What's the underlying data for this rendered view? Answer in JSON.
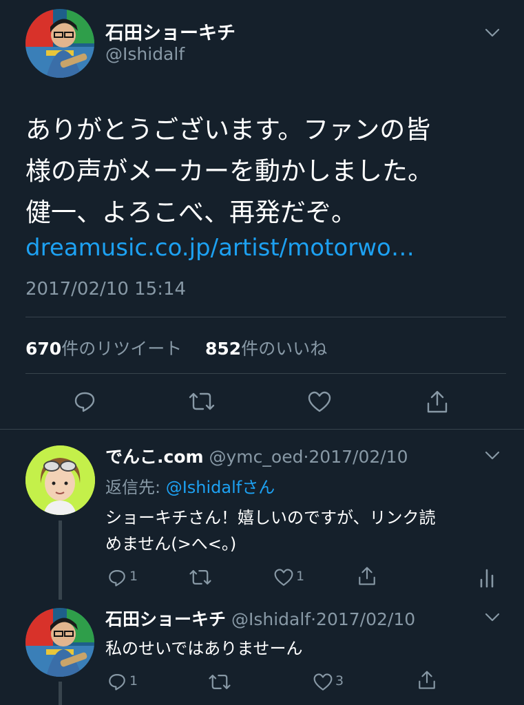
{
  "main_tweet": {
    "author_name": "石田ショーキチ",
    "author_handle": "@Ishidalf",
    "text_line1": "ありがとうございます。ファンの皆",
    "text_line2": "様の声がメーカーを動かしました。",
    "text_line3": "健一、よろこべ、再発だぞ。",
    "link": "dreamusic.co.jp/artist/motorwo…",
    "timestamp": "2017/02/10 15:14",
    "retweet_count": "670",
    "retweet_label": "件のリツイート",
    "like_count": "852",
    "like_label": "件のいいね"
  },
  "reply1": {
    "author_name": "でんこ.com",
    "author_handle": "@ymc_oed",
    "separator": "·",
    "date": "2017/02/10",
    "reply_to_label": "返信先: ",
    "reply_to_handle": "@Ishidalf",
    "reply_to_suffix": "さん",
    "text_line1": "ショーキチさん！嬉しいのですが、リンク読",
    "text_line2": "めません(>へ<。)",
    "reply_count": "1",
    "like_count": "1"
  },
  "reply2": {
    "author_name": "石田ショーキチ",
    "author_handle": "@Ishidalf",
    "separator": "·",
    "date": "2017/02/10",
    "text": "私のせいではありませーん",
    "reply_count": "1",
    "like_count": "3"
  },
  "icons": {
    "reply": "reply-icon",
    "retweet": "retweet-icon",
    "like": "heart-icon",
    "share": "share-icon",
    "analytics": "analytics-icon",
    "more": "chevron-down-icon"
  },
  "colors": {
    "background": "#15202b",
    "muted": "#8899a6",
    "link": "#1da1f2",
    "divider": "#38444d"
  }
}
